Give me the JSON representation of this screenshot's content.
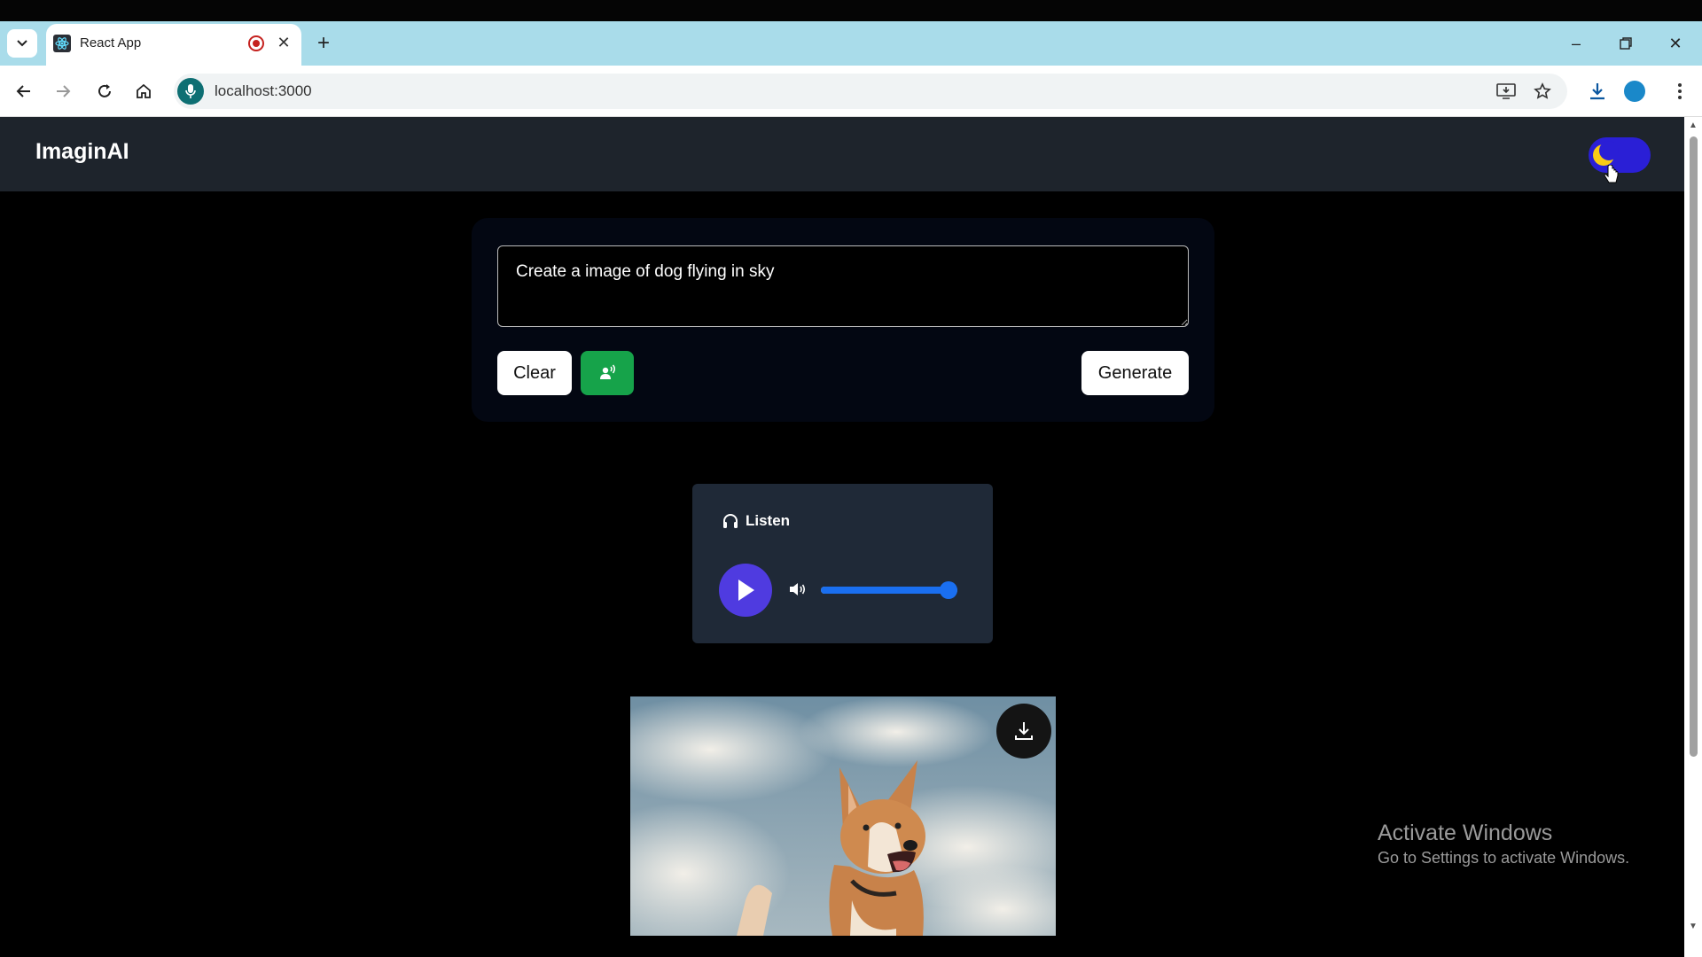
{
  "browser": {
    "tab_title": "React App",
    "url": "localhost:3000"
  },
  "app": {
    "brand": "ImaginAI",
    "theme_mode": "dark",
    "prompt_value": "Create a image of dog flying in sky",
    "clear_label": "Clear",
    "generate_label": "Generate",
    "listen_label": "Listen",
    "volume_level": 1.0,
    "accent_colors": {
      "voice_button": "#16a34a",
      "play_button": "#4f3be0",
      "slider": "#1a6ff0",
      "toggle": "#2a1fd6"
    }
  },
  "watermark": {
    "line1": "Activate Windows",
    "line2": "Go to Settings to activate Windows."
  }
}
